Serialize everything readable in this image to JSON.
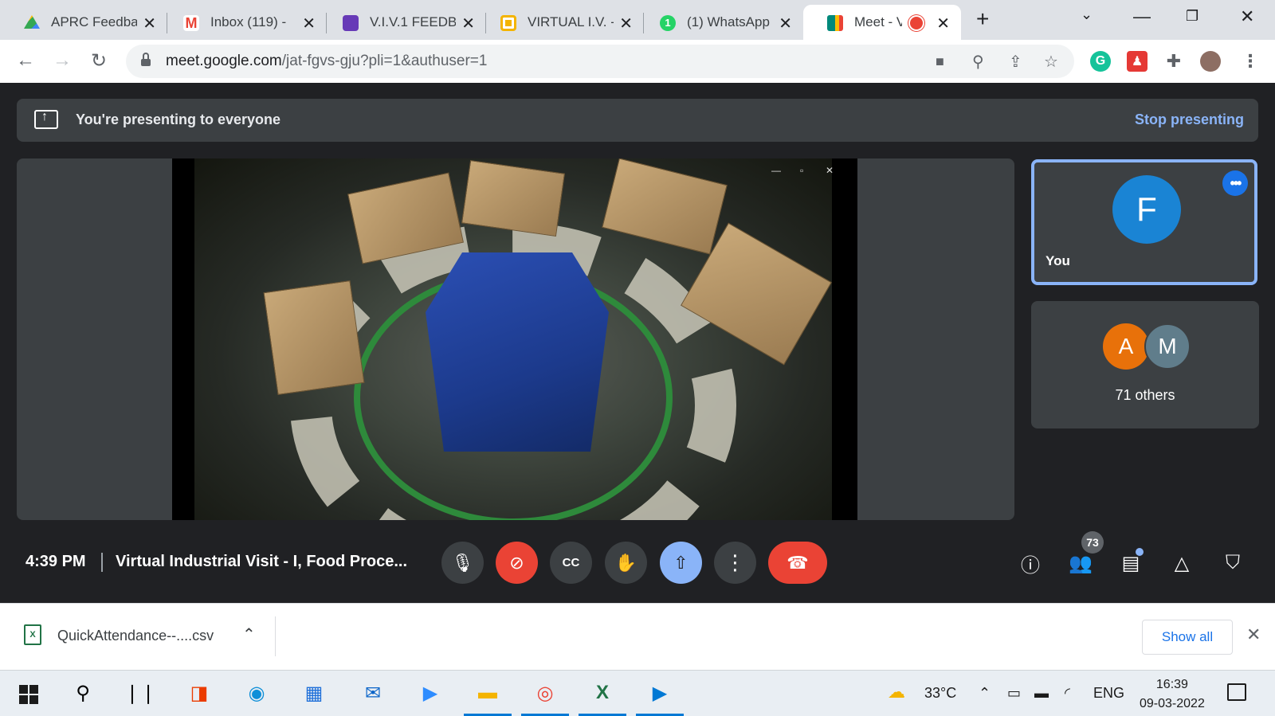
{
  "browser": {
    "tabs": [
      {
        "title": "APRC Feedba",
        "favicon": "google-drive-icon",
        "color": "#34a853"
      },
      {
        "title": "Inbox (119) -",
        "favicon": "gmail-icon",
        "color": "#ea4335"
      },
      {
        "title": "V.I.V.1 FEEDB/",
        "favicon": "google-forms-icon",
        "color": "#673ab7"
      },
      {
        "title": "VIRTUAL I.V. -",
        "favicon": "google-slides-icon",
        "color": "#f4b400"
      },
      {
        "title": "(1) WhatsApp",
        "favicon": "whatsapp-icon",
        "color": "#25d366"
      },
      {
        "title": "Meet - V",
        "favicon": "google-meet-icon",
        "color": "#00897b",
        "active": true
      }
    ],
    "url_host": "meet.google.com",
    "url_path": "/jat-fgvs-gju?pli=1&authuser=1"
  },
  "meet": {
    "banner_text": "You're presenting to everyone",
    "stop_label": "Stop presenting",
    "you": {
      "initial": "F",
      "label": "You",
      "color": "#1a84d4"
    },
    "others": {
      "initials": [
        "A",
        "M"
      ],
      "label": "71 others",
      "colors": [
        "#e8710a",
        "#607d8b"
      ]
    },
    "time": "4:39 PM",
    "meeting_name": "Virtual Industrial Visit - I, Food Proce...",
    "participant_count": "73",
    "accent_red": "#ea4335",
    "accent_blue": "#8ab4f8"
  },
  "downloads": {
    "file_name": "QuickAttendance--....csv",
    "show_all": "Show all"
  },
  "taskbar": {
    "weather_temp": "33°C",
    "language": "ENG",
    "time": "16:39",
    "date": "09-03-2022"
  }
}
